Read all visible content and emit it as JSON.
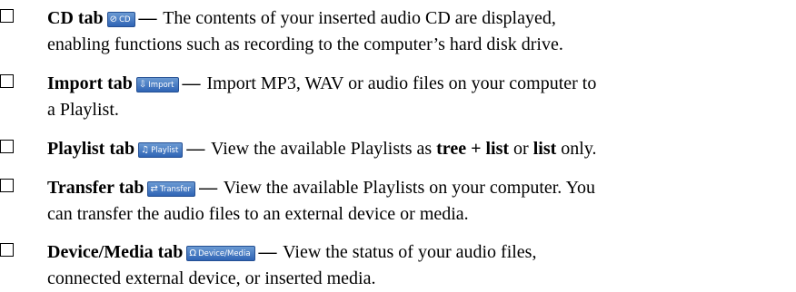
{
  "items": [
    {
      "title": "CD tab",
      "tab_icon": "cd-disc-icon",
      "tab_glyph": "⊘",
      "tab_label": "CD",
      "dash": "—",
      "desc_line1": "The contents of your inserted audio CD are displayed,",
      "desc_line2": "enabling functions such as recording to the computer’s hard disk drive."
    },
    {
      "title": "Import tab",
      "tab_icon": "import-icon",
      "tab_glyph": "⇩",
      "tab_label": "Import",
      "dash": "—",
      "desc_line1": "Import MP3, WAV or audio files on your computer to",
      "desc_line2": "a Playlist."
    },
    {
      "title": "Playlist tab",
      "tab_icon": "playlist-icon",
      "tab_glyph": "♫",
      "tab_label": "Playlist",
      "dash": "—",
      "desc_prefix": "View the available Playlists as ",
      "bold_a": "tree + list",
      "mid": " or ",
      "bold_b": "list",
      "suffix": " only."
    },
    {
      "title": "Transfer tab",
      "tab_icon": "transfer-icon",
      "tab_glyph": "⇄",
      "tab_label": "Transfer",
      "dash": "—",
      "desc_line1": "View the available Playlists on your computer. You",
      "desc_line2": "can transfer the audio files to an external device or media."
    },
    {
      "title": "Device/Media tab",
      "tab_icon": "headphones-icon",
      "tab_glyph": "Ω",
      "tab_label": "Device/Media",
      "dash": "—",
      "desc_line1": "View the status of your audio files,",
      "desc_line2": "connected external device, or inserted media."
    }
  ]
}
